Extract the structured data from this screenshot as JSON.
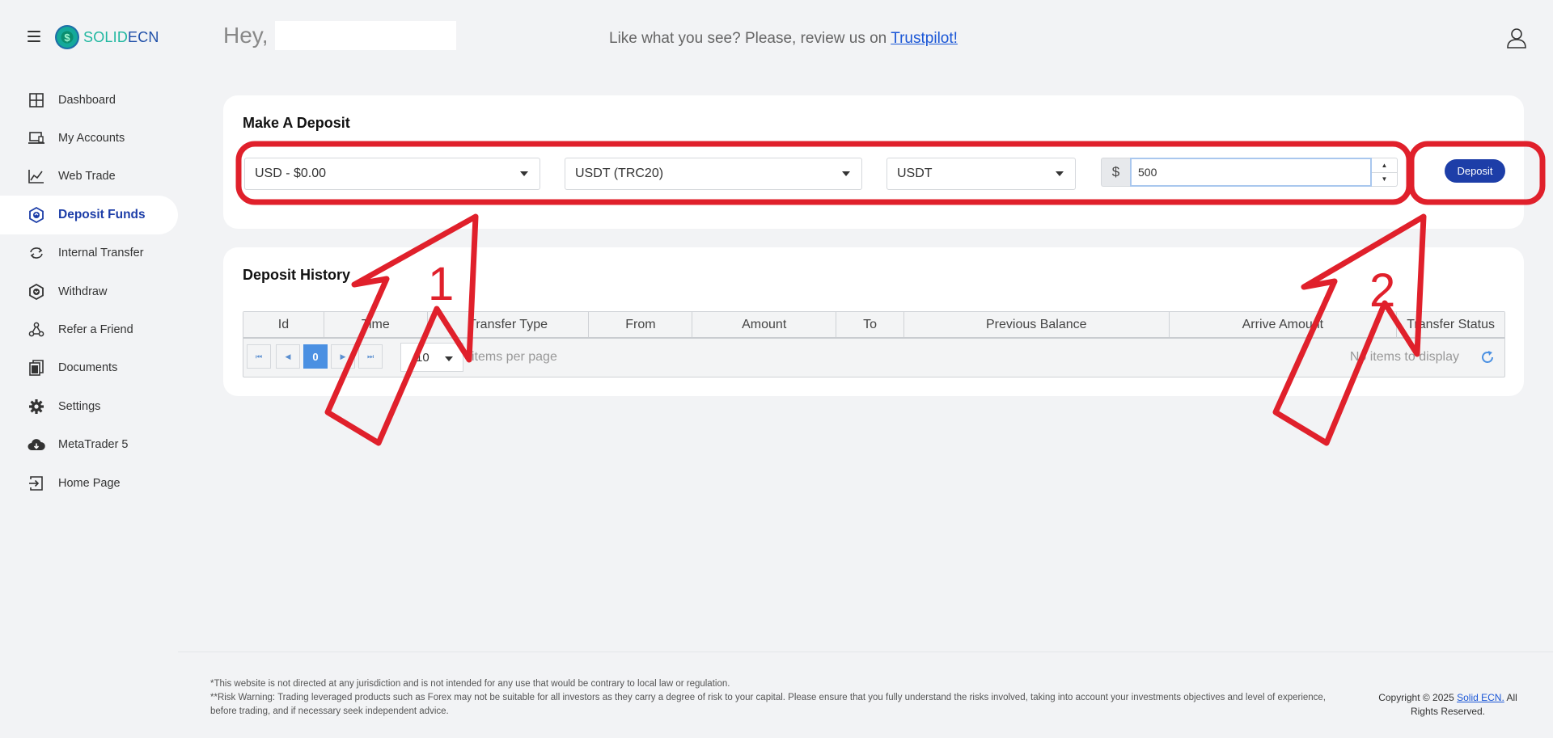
{
  "app": {
    "logo_part1": "SOLID",
    "logo_part2": "ECN"
  },
  "sidebar": {
    "items": [
      {
        "label": "Dashboard",
        "icon": "grid-icon"
      },
      {
        "label": "My Accounts",
        "icon": "monitor-icon"
      },
      {
        "label": "Web Trade",
        "icon": "chart-icon"
      },
      {
        "label": "Deposit Funds",
        "icon": "deposit-icon",
        "active": true
      },
      {
        "label": "Internal Transfer",
        "icon": "transfer-icon"
      },
      {
        "label": "Withdraw",
        "icon": "withdraw-icon"
      },
      {
        "label": "Refer a Friend",
        "icon": "share-icon"
      },
      {
        "label": "Documents",
        "icon": "documents-icon"
      },
      {
        "label": "Settings",
        "icon": "gear-icon"
      },
      {
        "label": "MetaTrader 5",
        "icon": "cloud-download-icon"
      },
      {
        "label": "Home Page",
        "icon": "exit-icon"
      }
    ]
  },
  "header": {
    "greeting": "Hey,",
    "promo_text": "Like what you see? Please, review us on ",
    "promo_link": "Trustpilot!"
  },
  "deposit": {
    "title": "Make A Deposit",
    "account_select": "USD - $0.00",
    "method_select": "USDT (TRC20)",
    "currency_select": "USDT",
    "amount_prefix": "$",
    "amount_value": "500",
    "button_label": "Deposit"
  },
  "history": {
    "title": "Deposit History",
    "columns": [
      "Id",
      "Time",
      "Transfer Type",
      "From",
      "Amount",
      "To",
      "Previous Balance",
      "Arrive Amount",
      "Transfer Status"
    ],
    "pager": {
      "current_page": "0",
      "page_size": "10",
      "items_per_page_label": "items per page",
      "empty_message": "No items to display"
    }
  },
  "annotations": {
    "label1": "1",
    "label2": "2",
    "color": "#e0202b"
  },
  "footer": {
    "disclaimer1": "*This website is not directed at any jurisdiction and is not intended for any use that would be contrary to local law or regulation.",
    "disclaimer2": "**Risk Warning: Trading leveraged products such as Forex may not be suitable for all investors as they carry a degree of risk to your capital. Please ensure that you fully understand the risks involved, taking into account your investments objectives and level of experience, before trading, and if necessary seek independent advice.",
    "copyright_prefix": "Copyright © 2025 ",
    "copyright_link": "Solid ECN.",
    "copyright_suffix": " All Rights Reserved."
  }
}
